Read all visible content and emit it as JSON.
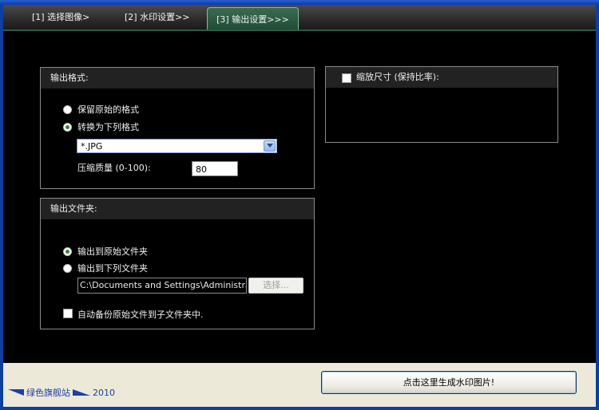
{
  "tabs": [
    {
      "label": "[1] 选择图像>"
    },
    {
      "label": "[2] 水印设置>>"
    },
    {
      "label": "[3] 输出设置>>>"
    }
  ],
  "output_format": {
    "title": "输出格式:",
    "option_keep": "保留原始的格式",
    "option_convert": "转换为下列格式",
    "selected_option": "option_convert",
    "format_value": "*.JPG",
    "quality_label": "压缩质量 (0-100):",
    "quality_value": "80"
  },
  "output_folder": {
    "title": "输出文件夹:",
    "option_original": "输出到原始文件夹",
    "option_custom": "输出到下列文件夹",
    "selected_option": "option_original",
    "path_value": "C:\\Documents and Settings\\Administrator\\桌",
    "browse_label": "选择...",
    "backup_label": "自动备份原始文件到子文件夹中.",
    "backup_checked": false
  },
  "resize": {
    "label": "缩放尺寸 (保持比率):",
    "checked": false
  },
  "footer": {
    "brand_name": "绿色旗舰站",
    "brand_year": "2010",
    "generate_label": "点击这里生成水印图片!"
  },
  "colors": {
    "background": "#000000",
    "active_tab": "#2f5c45",
    "bottom_bar": "#ece9d8",
    "brand": "#1c3fa8"
  }
}
